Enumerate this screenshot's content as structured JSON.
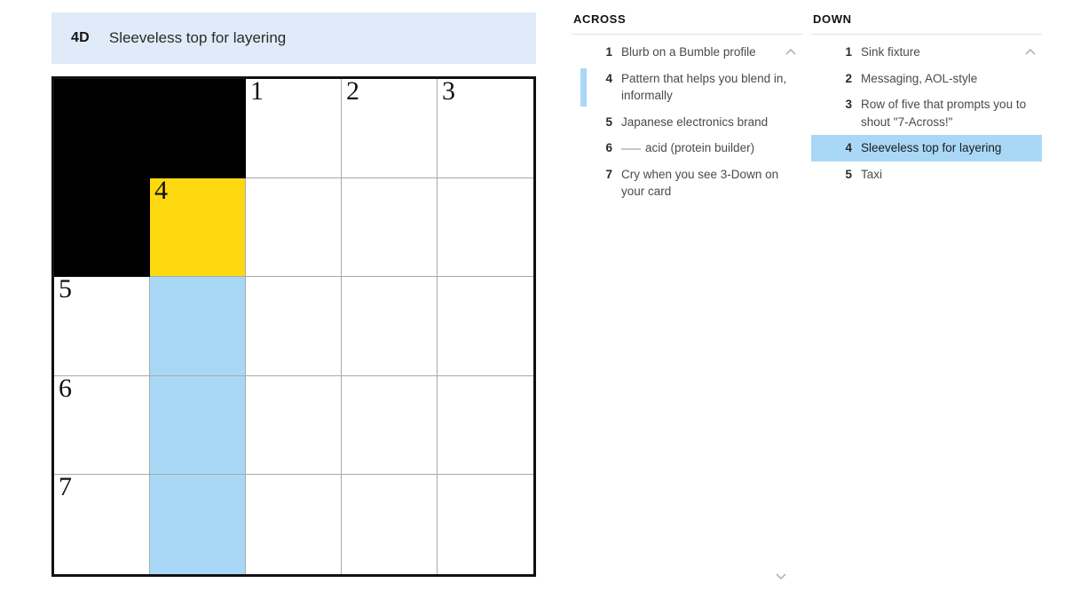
{
  "clue_bar": {
    "number": "4D",
    "text": "Sleeveless top for layering"
  },
  "grid": {
    "rows": 5,
    "cols": 5,
    "cells": [
      [
        {
          "type": "block"
        },
        {
          "type": "block"
        },
        {
          "type": "open",
          "number": "1",
          "letter": "",
          "state": "normal"
        },
        {
          "type": "open",
          "number": "2",
          "letter": "",
          "state": "normal"
        },
        {
          "type": "open",
          "number": "3",
          "letter": "",
          "state": "normal"
        }
      ],
      [
        {
          "type": "block"
        },
        {
          "type": "open",
          "number": "4",
          "letter": "",
          "state": "cursor"
        },
        {
          "type": "open",
          "number": "",
          "letter": "",
          "state": "normal"
        },
        {
          "type": "open",
          "number": "",
          "letter": "",
          "state": "normal"
        },
        {
          "type": "open",
          "number": "",
          "letter": "",
          "state": "normal"
        }
      ],
      [
        {
          "type": "open",
          "number": "5",
          "letter": "",
          "state": "normal"
        },
        {
          "type": "open",
          "number": "",
          "letter": "",
          "state": "word"
        },
        {
          "type": "open",
          "number": "",
          "letter": "",
          "state": "normal"
        },
        {
          "type": "open",
          "number": "",
          "letter": "",
          "state": "normal"
        },
        {
          "type": "open",
          "number": "",
          "letter": "",
          "state": "normal"
        }
      ],
      [
        {
          "type": "open",
          "number": "6",
          "letter": "",
          "state": "normal"
        },
        {
          "type": "open",
          "number": "",
          "letter": "",
          "state": "word"
        },
        {
          "type": "open",
          "number": "",
          "letter": "",
          "state": "normal"
        },
        {
          "type": "open",
          "number": "",
          "letter": "",
          "state": "normal"
        },
        {
          "type": "open",
          "number": "",
          "letter": "",
          "state": "normal"
        }
      ],
      [
        {
          "type": "open",
          "number": "7",
          "letter": "",
          "state": "normal"
        },
        {
          "type": "open",
          "number": "",
          "letter": "",
          "state": "word"
        },
        {
          "type": "open",
          "number": "",
          "letter": "",
          "state": "normal"
        },
        {
          "type": "open",
          "number": "",
          "letter": "",
          "state": "normal"
        },
        {
          "type": "open",
          "number": "",
          "letter": "",
          "state": "normal"
        }
      ]
    ]
  },
  "clues": {
    "across": {
      "heading": "ACROSS",
      "items": [
        {
          "number": "1",
          "text": "Blurb on a Bumble profile",
          "state": "normal"
        },
        {
          "number": "4",
          "text": "Pattern that helps you blend in, informally",
          "state": "crossing"
        },
        {
          "number": "5",
          "text": "Japanese electronics brand",
          "state": "normal"
        },
        {
          "number": "6",
          "text": "acid (protein builder)",
          "state": "normal",
          "leading_blank": true
        },
        {
          "number": "7",
          "text": "Cry when you see 3-Down on your card",
          "state": "normal"
        }
      ]
    },
    "down": {
      "heading": "DOWN",
      "items": [
        {
          "number": "1",
          "text": "Sink fixture",
          "state": "normal"
        },
        {
          "number": "2",
          "text": "Messaging, AOL-style",
          "state": "normal"
        },
        {
          "number": "3",
          "text": "Row of five that prompts you to shout \"7-Across!\"",
          "state": "normal"
        },
        {
          "number": "4",
          "text": "Sleeveless top for layering",
          "state": "active"
        },
        {
          "number": "5",
          "text": "Taxi",
          "state": "normal"
        }
      ]
    }
  },
  "controls": {
    "scroll_up_icon": "chevron-up-icon",
    "scroll_down_icon": "chevron-down-icon"
  },
  "colors": {
    "cursor_cell": "#ffd90f",
    "highlight_word": "#a9d8f7",
    "clue_bar_bg": "#dfebf8",
    "block_cell": "#000000",
    "grid_border": "#111111"
  }
}
